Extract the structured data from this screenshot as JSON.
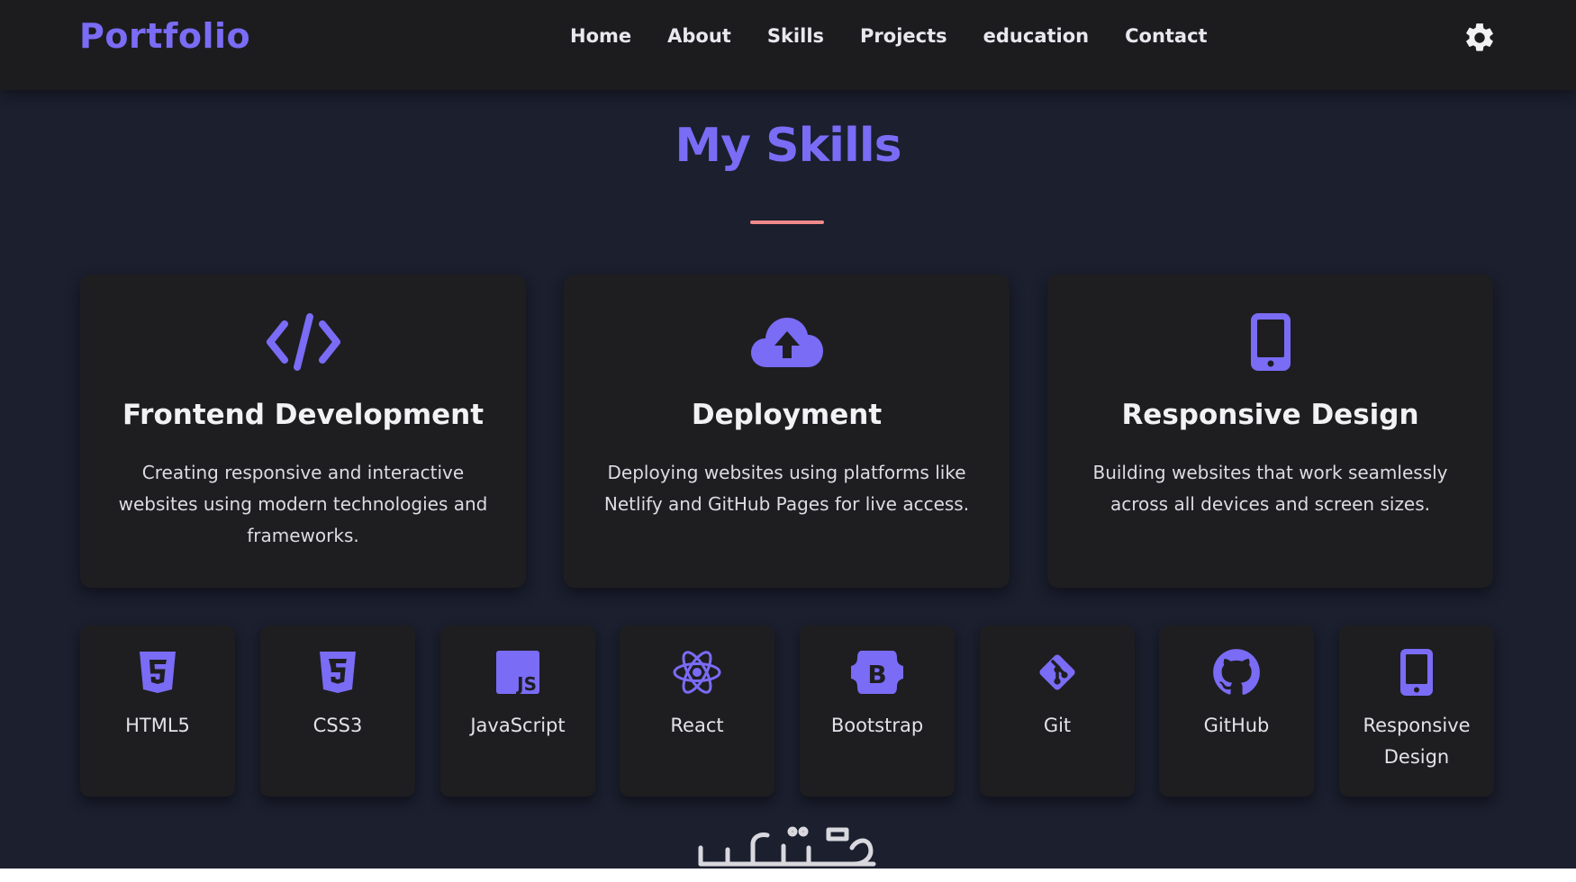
{
  "nav": {
    "logo": "Portfolio",
    "links": [
      "Home",
      "About",
      "Skills",
      "Projects",
      "education",
      "Contact"
    ],
    "theme_icon": "gear-icon"
  },
  "section": {
    "title": "My Skills",
    "underline_color": "#f08a8a",
    "accent_color": "#7a6cf5"
  },
  "cards": [
    {
      "icon": "code-icon",
      "title": "Frontend Development",
      "desc": "Creating responsive and interactive websites using modern technologies and frameworks."
    },
    {
      "icon": "cloud-upload-icon",
      "title": "Deployment",
      "desc": "Deploying websites using platforms like Netlify and GitHub Pages for live access."
    },
    {
      "icon": "mobile-icon",
      "title": "Responsive Design",
      "desc": "Building websites that work seamlessly across all devices and screen sizes."
    }
  ],
  "tech": [
    {
      "icon": "html5-icon",
      "label": "HTML5"
    },
    {
      "icon": "css3-icon",
      "label": "CSS3"
    },
    {
      "icon": "javascript-icon",
      "label": "JavaScript"
    },
    {
      "icon": "react-icon",
      "label": "React"
    },
    {
      "icon": "bootstrap-icon",
      "label": "Bootstrap"
    },
    {
      "icon": "git-icon",
      "label": "Git"
    },
    {
      "icon": "github-icon",
      "label": "GitHub"
    },
    {
      "icon": "mobile-icon",
      "label": "Responsive Design"
    }
  ],
  "watermark": "خمسات"
}
